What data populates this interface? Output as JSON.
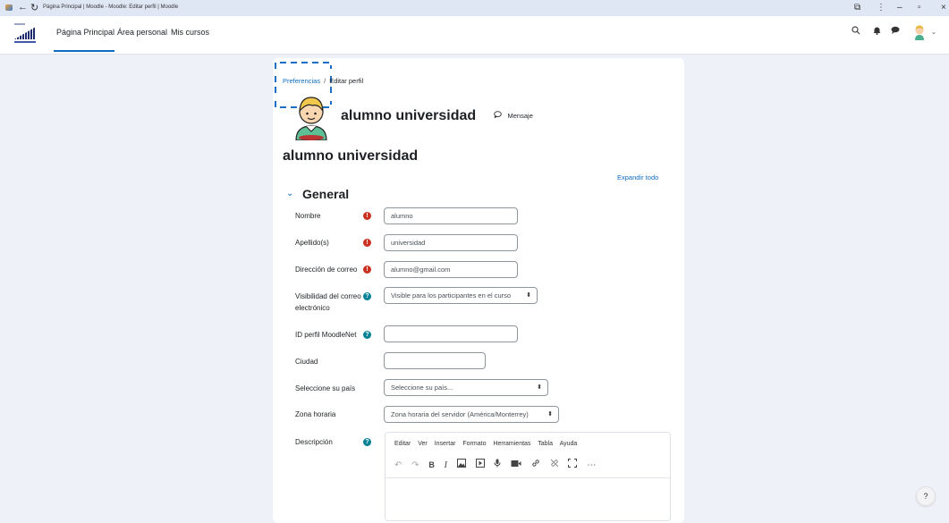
{
  "browser": {
    "tab_title": "Página Principal | Moodle - Moodle: Editar perfil | Moodle"
  },
  "nav": {
    "links": [
      "Página Principal",
      "Área personal",
      "Mis cursos"
    ]
  },
  "breadcrumb": {
    "parent": "Preferencias",
    "separator": "/",
    "current": "Editar perfil"
  },
  "profile": {
    "name": "alumno universidad",
    "message_label": "Mensaje"
  },
  "page": {
    "heading": "alumno universidad",
    "expand_all": "Expandir todo",
    "section_title": "General"
  },
  "form": {
    "nombre_label": "Nombre",
    "nombre_value": "alumno",
    "apellido_label": "Apellido(s)",
    "apellido_value": "universidad",
    "email_label": "Dirección de correo",
    "email_value": "alumno@gmail.com",
    "visibilidad_label": "Visibilidad del correo electrónico",
    "visibilidad_value": "Visible para los participantes en el curso",
    "moodlenet_label": "ID perfil MoodleNet",
    "moodlenet_value": "",
    "ciudad_label": "Ciudad",
    "ciudad_value": "",
    "pais_label": "Seleccione su país",
    "pais_value": "Seleccione su país...",
    "zona_label": "Zona horaria",
    "zona_value": "Zona horaria del servidor (América/Monterrey)",
    "descripcion_label": "Descripción"
  },
  "editor": {
    "menu": [
      "Editar",
      "Ver",
      "Insertar",
      "Formato",
      "Herramientas",
      "Tabla",
      "Ayuda"
    ]
  },
  "help_button": "?",
  "colors": {
    "accent": "#0f6cbf",
    "required": "#ca3120",
    "help": "#008196",
    "page_bg": "#eef2f8"
  }
}
